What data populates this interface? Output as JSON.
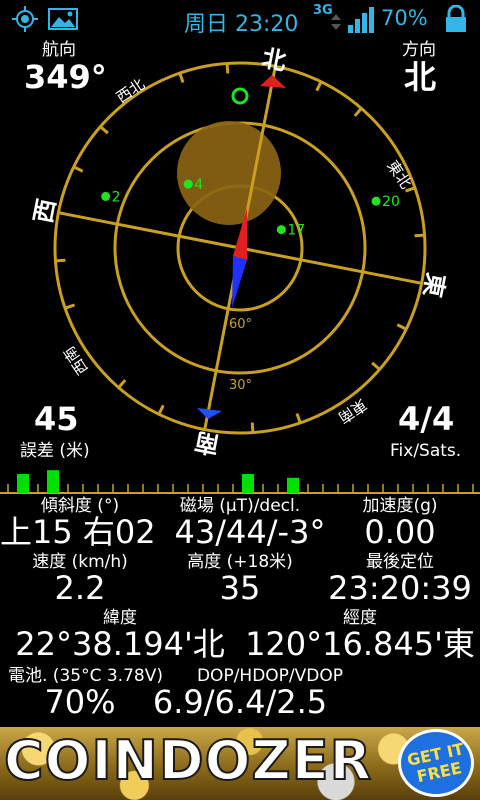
{
  "status_bar": {
    "time": "周日 23:20",
    "network": "3G",
    "battery": "70%",
    "accent": "#33b5e5"
  },
  "heading": {
    "label": "航向",
    "value": "349°"
  },
  "direction": {
    "label": "方向",
    "value": "北"
  },
  "accuracy": {
    "value": "45",
    "label": "誤差 (米)"
  },
  "fix": {
    "value": "4/4",
    "label": "Fix/Sats."
  },
  "compass": {
    "cardinals": {
      "north": "北",
      "east": "東",
      "south": "南",
      "west": "西"
    },
    "intercardinals": {
      "nw": "西北",
      "ne": "東北",
      "se": "東南",
      "sw": "西南"
    },
    "elevation_labels": [
      "60°",
      "30°"
    ],
    "satellites": [
      {
        "id": "2",
        "az": 280,
        "elev": 20
      },
      {
        "id": "4",
        "az": 310,
        "elev": 50
      },
      {
        "id": "17",
        "az": 55,
        "elev": 68
      },
      {
        "id": "20",
        "az": 60,
        "elev": 20
      }
    ],
    "ring_color": "#c9a020",
    "sat_color": "#1ee61e"
  },
  "signal_bars": [
    {
      "strength": 0.5,
      "color": "#00e000"
    },
    {
      "strength": 0.6,
      "color": "#00e000"
    },
    {
      "strength": 0.0,
      "color": "#00e000"
    },
    {
      "strength": 0.5,
      "color": "#00e000"
    },
    {
      "strength": 0.4,
      "color": "#00e000"
    }
  ],
  "panel": {
    "tilt": {
      "label": "傾斜度 (°)",
      "value": "上15 右02"
    },
    "mag": {
      "label": "磁場 (µT)/decl.",
      "value": "43/44/-3°"
    },
    "accel": {
      "label": "加速度(g)",
      "value": "0.00"
    },
    "speed": {
      "label": "速度 (km/h)",
      "value": "2.2"
    },
    "alt": {
      "label": "高度 (+18米)",
      "value": "35"
    },
    "last": {
      "label": "最後定位",
      "value": "23:20:39"
    },
    "lat": {
      "label": "緯度",
      "value": "22°38.194'北"
    },
    "lon": {
      "label": "經度",
      "value": "120°16.845'東"
    },
    "batt": {
      "label": "電池. (35°C 3.78V)",
      "value": "70%"
    },
    "dop": {
      "label": "DOP/HDOP/VDOP",
      "value": "6.9/6.4/2.5"
    }
  },
  "ad": {
    "title": "COINDOZER",
    "cta": "GET IT FREE"
  }
}
